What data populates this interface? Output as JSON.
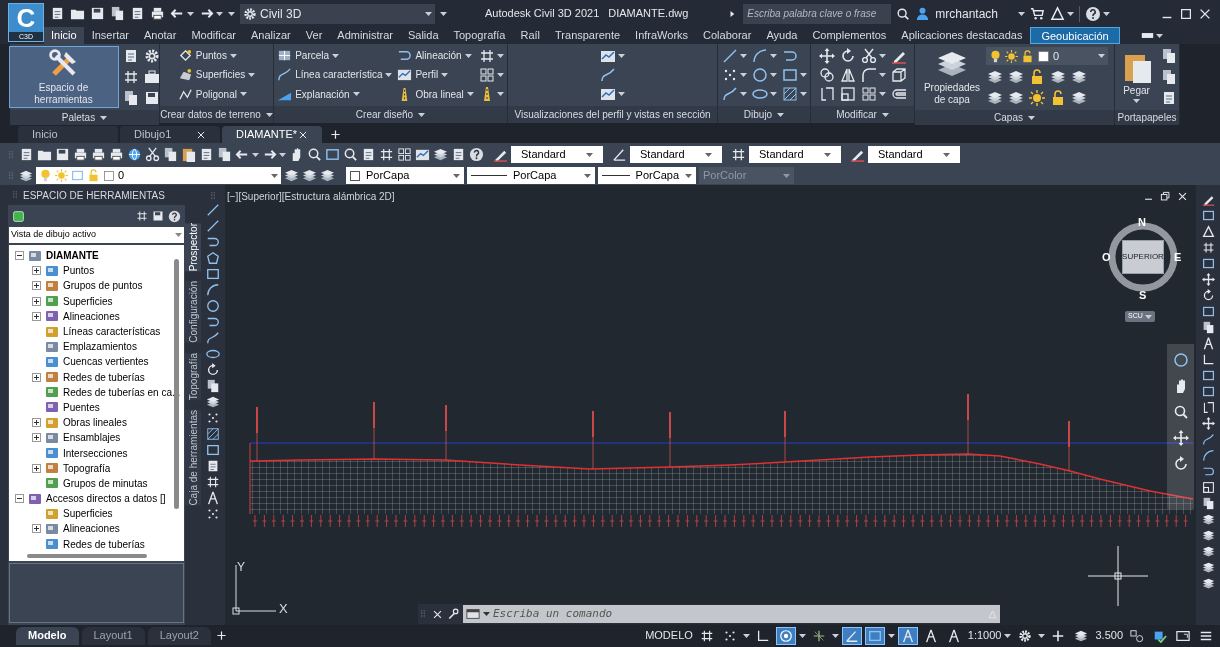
{
  "app": {
    "logo_letter": "C",
    "logo_badge": "C3D",
    "workspace": "Civil 3D",
    "product": "Autodesk Civil 3D 2021",
    "file": "DIAMANTE.dwg",
    "search_placeholder": "Escriba palabra clave o frase",
    "user": "mrchantach"
  },
  "ribbon_tabs": [
    {
      "label": "Inicio",
      "selected": true,
      "kind": "tab"
    },
    {
      "label": "Insertar",
      "selected": false,
      "kind": "tab"
    },
    {
      "label": "Anotar",
      "selected": false,
      "kind": "tab"
    },
    {
      "label": "Modificar",
      "selected": false,
      "kind": "tab"
    },
    {
      "label": "Analizar",
      "selected": false,
      "kind": "tab"
    },
    {
      "label": "Ver",
      "selected": false,
      "kind": "tab"
    },
    {
      "label": "Administrar",
      "selected": false,
      "kind": "tab"
    },
    {
      "label": "Salida",
      "selected": false,
      "kind": "tab"
    },
    {
      "label": "Topografía",
      "selected": false,
      "kind": "tab"
    },
    {
      "label": "Raíl",
      "selected": false,
      "kind": "tab"
    },
    {
      "label": "Transparente",
      "selected": false,
      "kind": "tab"
    },
    {
      "label": "InfraWorks",
      "selected": false,
      "kind": "tab"
    },
    {
      "label": "Colaborar",
      "selected": false,
      "kind": "tab"
    },
    {
      "label": "Ayuda",
      "selected": false,
      "kind": "tab"
    },
    {
      "label": "Complementos",
      "selected": false,
      "kind": "tab"
    },
    {
      "label": "Aplicaciones destacadas",
      "selected": false,
      "kind": "tab"
    },
    {
      "label": "Geoubicación",
      "selected": false,
      "kind": "contextual"
    }
  ],
  "ribbon_panels": [
    {
      "title": "Paletas",
      "menu": true,
      "columns": [
        [
          [
            {
              "kind": "large",
              "label": "Espacio de herramientas",
              "selected": true,
              "caret": false
            }
          ]
        ],
        [
          [
            {
              "kind": "icon",
              "caret": false
            },
            {
              "kind": "icon",
              "caret": false
            }
          ],
          [
            {
              "kind": "icon",
              "caret": false
            },
            {
              "kind": "icon",
              "caret": false
            }
          ],
          [
            {
              "kind": "icon",
              "caret": false
            },
            {
              "kind": "icon",
              "caret": false
            }
          ]
        ]
      ]
    },
    {
      "title": "Crear datos de terreno",
      "menu": true,
      "columns": [
        [
          [
            {
              "kind": "row",
              "label": "Puntos",
              "caret": true
            }
          ],
          [
            {
              "kind": "row",
              "label": "Superficies",
              "caret": true
            }
          ],
          [
            {
              "kind": "row",
              "label": "Poligonal",
              "caret": true
            }
          ]
        ]
      ]
    },
    {
      "title": "Crear diseño",
      "menu": true,
      "columns": [
        [
          [
            {
              "kind": "row",
              "label": "Parcela",
              "caret": true
            }
          ],
          [
            {
              "kind": "row",
              "label": "Línea característica",
              "caret": true
            }
          ],
          [
            {
              "kind": "row",
              "label": "Explanación",
              "caret": true
            }
          ]
        ],
        [
          [
            {
              "kind": "row",
              "label": "Alineación",
              "caret": true
            }
          ],
          [
            {
              "kind": "row",
              "label": "Perfil",
              "caret": true
            }
          ],
          [
            {
              "kind": "row",
              "label": "Obra lineal",
              "caret": true
            }
          ]
        ],
        [
          [
            {
              "kind": "icon",
              "caret": true
            }
          ],
          [
            {
              "kind": "icon",
              "caret": true
            }
          ],
          [
            {
              "kind": "icon",
              "caret": true
            }
          ]
        ]
      ]
    },
    {
      "title": "Visualizaciones del perfil y vistas en sección",
      "menu": false,
      "columns": [
        [
          [
            {
              "kind": "icon",
              "caret": true
            }
          ],
          [
            {
              "kind": "icon",
              "caret": false
            }
          ],
          [
            {
              "kind": "icon",
              "caret": true
            }
          ]
        ]
      ]
    },
    {
      "title": "Dibujo",
      "menu": true,
      "columns": [
        [
          [
            {
              "kind": "icon",
              "caret": true
            },
            {
              "kind": "icon",
              "caret": true
            },
            {
              "kind": "icon",
              "caret": false
            }
          ],
          [
            {
              "kind": "icon",
              "caret": true
            },
            {
              "kind": "icon",
              "caret": true
            },
            {
              "kind": "icon",
              "caret": true
            }
          ],
          [
            {
              "kind": "icon",
              "caret": true
            },
            {
              "kind": "icon",
              "caret": true
            },
            {
              "kind": "icon",
              "caret": true
            }
          ]
        ]
      ]
    },
    {
      "title": "Modificar",
      "menu": true,
      "columns": [
        [
          [
            {
              "kind": "icon",
              "caret": false
            },
            {
              "kind": "icon",
              "caret": false
            },
            {
              "kind": "icon",
              "caret": true
            },
            {
              "kind": "icon",
              "caret": false
            }
          ],
          [
            {
              "kind": "icon",
              "caret": false
            },
            {
              "kind": "icon",
              "caret": false
            },
            {
              "kind": "icon",
              "caret": true
            },
            {
              "kind": "icon",
              "caret": false
            }
          ],
          [
            {
              "kind": "icon",
              "caret": false
            },
            {
              "kind": "icon",
              "caret": false
            },
            {
              "kind": "icon",
              "caret": true
            },
            {
              "kind": "icon",
              "caret": false
            }
          ]
        ]
      ]
    },
    {
      "title": "Capas",
      "menu": true,
      "columns": [
        [
          [
            {
              "kind": "large",
              "label": "Propiedades de capa",
              "selected": false,
              "caret": false
            }
          ]
        ],
        [
          [
            {
              "kind": "layer",
              "label": "0",
              "caret": true
            }
          ],
          [
            {
              "kind": "icon",
              "caret": false
            },
            {
              "kind": "icon",
              "caret": false
            },
            {
              "kind": "icon",
              "caret": false
            },
            {
              "kind": "icon",
              "caret": false
            },
            {
              "kind": "icon",
              "caret": false
            }
          ],
          [
            {
              "kind": "icon",
              "caret": false
            },
            {
              "kind": "icon",
              "caret": false
            },
            {
              "kind": "icon",
              "caret": false
            },
            {
              "kind": "icon",
              "caret": false
            },
            {
              "kind": "icon",
              "caret": false
            }
          ]
        ]
      ]
    },
    {
      "title": "Portapapeles",
      "menu": false,
      "columns": [
        [
          [
            {
              "kind": "large",
              "label": "Pegar",
              "selected": false,
              "caret": true
            }
          ]
        ],
        [
          [
            {
              "kind": "icon",
              "caret": false
            }
          ],
          [
            {
              "kind": "icon",
              "caret": false
            }
          ],
          [
            {
              "kind": "icon",
              "caret": false
            }
          ]
        ]
      ]
    }
  ],
  "file_tabs": [
    {
      "label": "Inicio",
      "selected": false,
      "closable": false
    },
    {
      "label": "Dibujo1",
      "selected": false,
      "closable": true
    },
    {
      "label": "DIAMANTE*",
      "selected": true,
      "closable": true
    }
  ],
  "style_dropdowns": [
    "Standard",
    "Standard",
    "Standard",
    "Standard"
  ],
  "properties_toolbar": {
    "layer": "0",
    "items": [
      {
        "kind": "color",
        "label": "PorCapa",
        "disabled": false
      },
      {
        "kind": "linetype",
        "label": "PorCapa",
        "disabled": false
      },
      {
        "kind": "lineweight",
        "label": "PorCapa",
        "disabled": false
      },
      {
        "kind": "plotstyle",
        "label": "PorColor",
        "disabled": true
      }
    ]
  },
  "palette": {
    "title": "ESPACIO DE HERRAMIENTAS",
    "view": "Vista de dibujo activo",
    "tree": [
      {
        "label": "DIAMANTE",
        "kind": "node",
        "expanded": true,
        "active": true,
        "children": [
          {
            "label": "Puntos",
            "kind": "node",
            "expanded": false
          },
          {
            "label": "Grupos de puntos",
            "kind": "node",
            "expanded": false
          },
          {
            "label": "Superficies",
            "kind": "node",
            "expanded": false
          },
          {
            "label": "Alineaciones",
            "kind": "node",
            "expanded": false
          },
          {
            "label": "Líneas características",
            "kind": "leaf"
          },
          {
            "label": "Emplazamientos",
            "kind": "leaf"
          },
          {
            "label": "Cuencas vertientes",
            "kind": "leaf"
          },
          {
            "label": "Redes de tuberías",
            "kind": "node",
            "expanded": false
          },
          {
            "label": "Redes de tuberías en ca...",
            "kind": "leaf"
          },
          {
            "label": "Puentes",
            "kind": "leaf"
          },
          {
            "label": "Obras lineales",
            "kind": "node",
            "expanded": false
          },
          {
            "label": "Ensamblajes",
            "kind": "node",
            "expanded": false
          },
          {
            "label": "Intersecciones",
            "kind": "leaf"
          },
          {
            "label": "Topografía",
            "kind": "node",
            "expanded": false
          },
          {
            "label": "Grupos de minutas",
            "kind": "leaf"
          }
        ]
      },
      {
        "label": "Accesos directos a datos []",
        "kind": "node",
        "expanded": true,
        "active": false,
        "children": [
          {
            "label": "Superficies",
            "kind": "leaf"
          },
          {
            "label": "Alineaciones",
            "kind": "node",
            "expanded": false
          },
          {
            "label": "Redes de tuberías",
            "kind": "leaf"
          }
        ]
      }
    ],
    "side_tabs": [
      {
        "label": "Prospector",
        "selected": true
      },
      {
        "label": "Configuración",
        "selected": false
      },
      {
        "label": "Topografía",
        "selected": false
      },
      {
        "label": "Caja de herramientas",
        "selected": false
      }
    ]
  },
  "viewport": {
    "label": "[−][Superior][Estructura alámbrica 2D]",
    "viewcube": {
      "north": "N",
      "south": "S",
      "east": "E",
      "west": "O",
      "face": "SUPERIOR",
      "ucs": "SCU"
    },
    "ucs_axes": {
      "x": "X",
      "y": "Y"
    }
  },
  "command_line": {
    "placeholder": "Escriba un comando"
  },
  "layout_tabs": [
    {
      "label": "Modelo",
      "selected": true
    },
    {
      "label": "Layout1",
      "selected": false
    },
    {
      "label": "Layout2",
      "selected": false
    }
  ],
  "status_bar": [
    {
      "kind": "text",
      "label": "MODELO",
      "caret": false
    },
    {
      "kind": "toggle",
      "on": false,
      "caret": false
    },
    {
      "kind": "toggle",
      "on": false,
      "caret": true
    },
    {
      "kind": "toggle",
      "on": false,
      "caret": false
    },
    {
      "kind": "toggle",
      "on": true,
      "caret": true
    },
    {
      "kind": "toggle",
      "on": false,
      "caret": true
    },
    {
      "kind": "toggle",
      "on": true,
      "caret": false
    },
    {
      "kind": "toggle",
      "on": true,
      "caret": true
    },
    {
      "kind": "toggle",
      "on": true,
      "caret": false
    },
    {
      "kind": "toggle",
      "on": false,
      "caret": false
    },
    {
      "kind": "toggle",
      "on": false,
      "caret": false
    },
    {
      "kind": "text",
      "label": "1:1000",
      "caret": true
    },
    {
      "kind": "toggle",
      "on": false,
      "caret": true
    },
    {
      "kind": "toggle",
      "on": false,
      "caret": false
    },
    {
      "kind": "toggle",
      "on": false,
      "caret": false
    },
    {
      "kind": "text",
      "label": "3.500",
      "caret": false
    },
    {
      "kind": "toggle",
      "on": false,
      "caret": false
    },
    {
      "kind": "toggle",
      "on": false,
      "caret": false
    },
    {
      "kind": "toggle",
      "on": false,
      "caret": false
    },
    {
      "kind": "toggle",
      "on": false,
      "caret": false
    }
  ]
}
